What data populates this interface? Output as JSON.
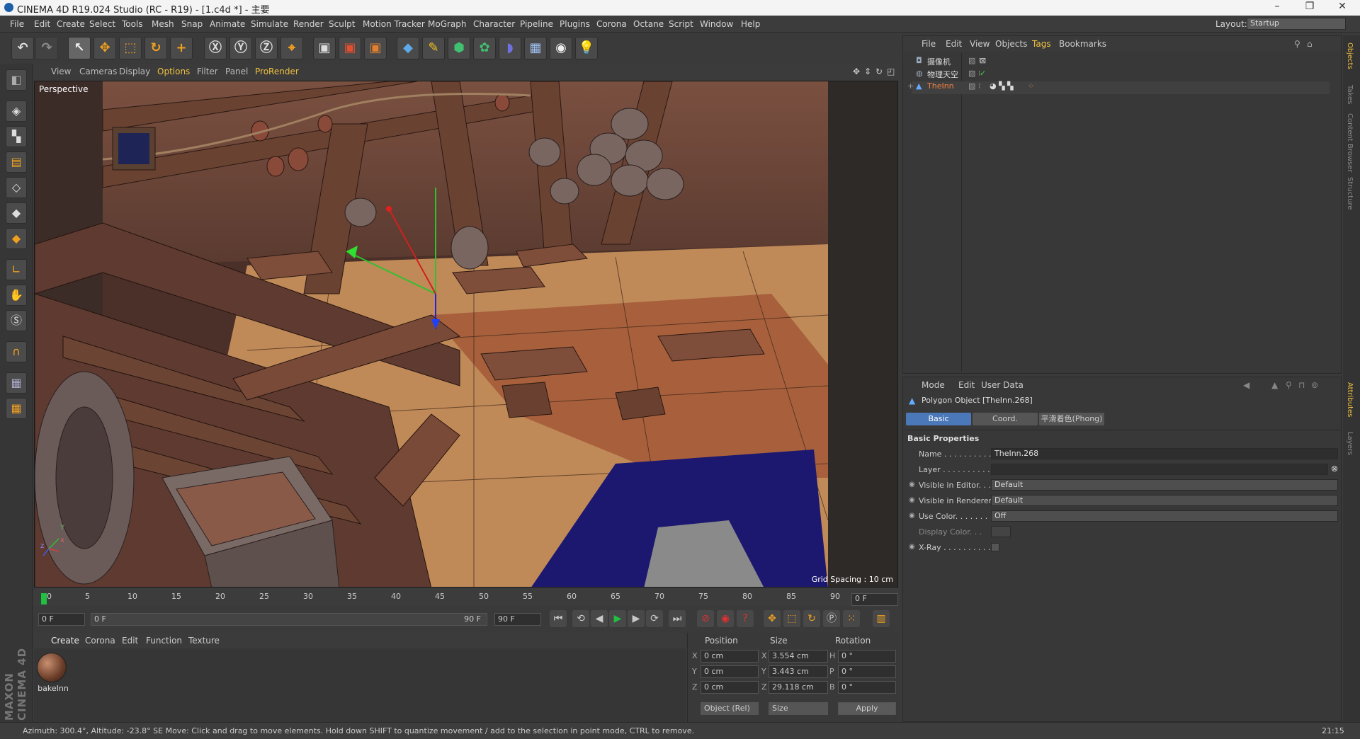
{
  "window": {
    "title": "CINEMA 4D R19.024 Studio (RC - R19) - [1.c4d *] - 主要",
    "minimize": "–",
    "restore": "❐",
    "close": "✕"
  },
  "menubar": {
    "items": [
      "File",
      "Edit",
      "Create",
      "Select",
      "Tools",
      "Mesh",
      "Snap",
      "Animate",
      "Simulate",
      "Render",
      "Sculpt",
      "Motion Tracker",
      "MoGraph",
      "Character",
      "Pipeline",
      "Plugins",
      "Corona",
      "Octane",
      "Script",
      "Window",
      "Help"
    ],
    "layout_label": "Layout:",
    "layout_value": "Startup"
  },
  "viewport": {
    "menu": [
      "View",
      "Cameras",
      "Display",
      "Options",
      "Filter",
      "Panel",
      "ProRender"
    ],
    "label": "Perspective",
    "grid_spacing": "Grid Spacing : 10 cm",
    "axis_x": "x",
    "axis_y": "Y",
    "axis_z": "z"
  },
  "timeline": {
    "ticks": [
      "0",
      "5",
      "10",
      "15",
      "20",
      "25",
      "30",
      "35",
      "40",
      "45",
      "50",
      "55",
      "60",
      "65",
      "70",
      "75",
      "80",
      "85",
      "90"
    ],
    "current_frame": "0 F",
    "start_field": "0 F",
    "range_start": "0 F",
    "range_end": "90 F",
    "end_field": "90 F"
  },
  "materials": {
    "menu": [
      "Create",
      "Corona",
      "Edit",
      "Function",
      "Texture"
    ],
    "items": [
      {
        "name": "bakeInn"
      }
    ],
    "brand": "MAXON CINEMA 4D"
  },
  "coords": {
    "headers": {
      "position": "Position",
      "size": "Size",
      "rotation": "Rotation"
    },
    "rows": [
      {
        "axis": "X",
        "pos": "0 cm",
        "size_axis": "X",
        "size": "3.554 cm",
        "rot_axis": "H",
        "rot": "0 °"
      },
      {
        "axis": "Y",
        "pos": "0 cm",
        "size_axis": "Y",
        "size": "3.443 cm",
        "rot_axis": "P",
        "rot": "0 °"
      },
      {
        "axis": "Z",
        "pos": "0 cm",
        "size_axis": "Z",
        "size": "29.118 cm",
        "rot_axis": "B",
        "rot": "0 °"
      }
    ],
    "mode_select": "Object (Rel)",
    "size_select": "Size",
    "apply": "Apply"
  },
  "object_manager": {
    "menu": [
      "File",
      "Edit",
      "View",
      "Objects",
      "Tags",
      "Bookmarks"
    ],
    "objects": [
      {
        "name": "摄像机",
        "selected": false
      },
      {
        "name": "物理天空",
        "selected": false
      },
      {
        "name": "TheInn",
        "selected": true
      }
    ]
  },
  "attribute_manager": {
    "menu": [
      "Mode",
      "Edit",
      "User Data"
    ],
    "object_title": "Polygon Object [TheInn.268]",
    "tabs": [
      "Basic",
      "Coord.",
      "平滑着色(Phong)"
    ],
    "active_tab": "Basic",
    "section": "Basic Properties",
    "props": [
      {
        "label": "Name . . . . . . . . . . . .",
        "value": "TheInn.268"
      },
      {
        "label": "Layer . . . . . . . . . . . .",
        "value": ""
      },
      {
        "label": "Visible in Editor. . .",
        "value": "Default"
      },
      {
        "label": "Visible in Renderer",
        "value": "Default"
      },
      {
        "label": "Use Color. . . . . . . .",
        "value": "Off"
      },
      {
        "label": "Display Color. . .",
        "value": ""
      },
      {
        "label": "X-Ray . . . . . . . . . . .",
        "value": ""
      }
    ]
  },
  "side_tabs": [
    "Objects",
    "Takes",
    "Content Browser",
    "Structure",
    "Attributes",
    "Layers"
  ],
  "status": {
    "text": "Azimuth: 300.4°, Altitude: -23.8°  SE     Move: Click and drag to move elements. Hold down SHIFT to quantize movement / add to the selection in point mode, CTRL to remove.",
    "clock": "21:15"
  },
  "icons": {
    "undo": "undo-icon",
    "redo": "redo-icon",
    "select": "arrow-select-icon",
    "move": "move-icon",
    "scale": "scale-icon",
    "rotate": "rotate-icon"
  }
}
